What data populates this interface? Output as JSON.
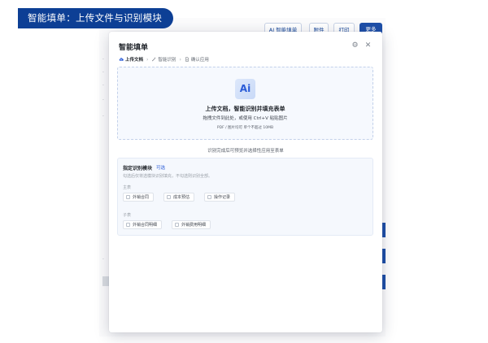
{
  "caption": "智能填单：上传文件与识别模块",
  "background": {
    "toolbar_buttons": [
      "AI 智能填单",
      "附件",
      "打印",
      "更多"
    ]
  },
  "modal": {
    "title": "智能填单",
    "steps": [
      "上传文档",
      "智能识别",
      "确认应用"
    ],
    "upload": {
      "ai_logo": "Ai",
      "title": "上传文档，智能识别并填充表单",
      "subtitle": "拖拽文件到此处，或使用 Ctrl+V 粘贴图片",
      "hint": "PDF / 图片均可    单个不超过 10MB"
    },
    "notice": "识别完成后可预览并选择性应用至表单",
    "module_card": {
      "title": "指定识别模块",
      "tag": "可选",
      "help": "勾选后仅将选模块识别填充，不勾选则识别全部。",
      "groups": [
        {
          "label": "主表",
          "options": [
            "外销合同",
            "成本预估",
            "操作记录"
          ]
        },
        {
          "label": "子表",
          "options": [
            "外销合同明细",
            "外销费用明细"
          ]
        }
      ]
    }
  },
  "colors": {
    "banner": "#0d3f95",
    "accent": "#2a5bd7",
    "upload_bg": "#f6f9fe"
  }
}
